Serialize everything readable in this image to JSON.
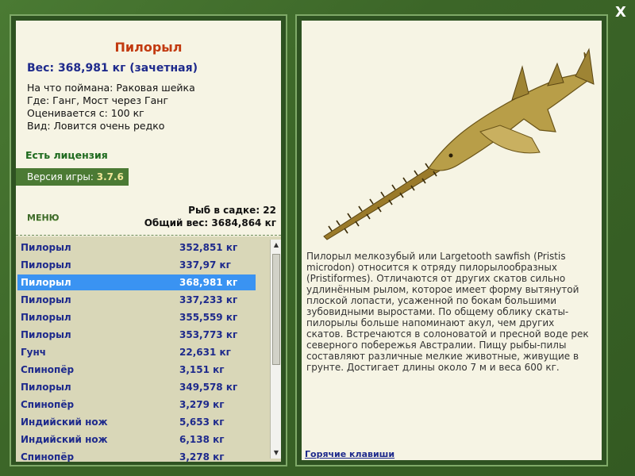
{
  "window": {
    "close_label": "X"
  },
  "fish": {
    "title": "Пилорыл",
    "weight_line": "Вес: 368,981 кг (зачетная)",
    "caught_on": "На что поймана: Раковая шейка",
    "location": "Где: Ганг, Мост через Ганг",
    "valued_from": "Оценивается с: 100 кг",
    "rarity": "Вид: Ловится очень редко"
  },
  "license": "Есть лицензия",
  "version": {
    "label": "Версия игры:",
    "value": "3.7.6"
  },
  "menu_label": "МЕНЮ",
  "stats": {
    "cage_count": "Рыб в садке: 22",
    "total_weight": "Общий вес: 3684,864 кг"
  },
  "catch_list": [
    {
      "name": "Пилорыл",
      "weight": "352,851 кг"
    },
    {
      "name": "Пилорыл",
      "weight": "337,97 кг"
    },
    {
      "name": "Пилорыл",
      "weight": "368,981 кг",
      "selected": true
    },
    {
      "name": "Пилорыл",
      "weight": "337,233 кг"
    },
    {
      "name": "Пилорыл",
      "weight": "355,559 кг"
    },
    {
      "name": "Пилорыл",
      "weight": "353,773 кг"
    },
    {
      "name": "Гунч",
      "weight": "22,631 кг"
    },
    {
      "name": "Спинопёр",
      "weight": "3,151 кг"
    },
    {
      "name": "Пилорыл",
      "weight": "349,578 кг"
    },
    {
      "name": "Спинопёр",
      "weight": "3,279 кг"
    },
    {
      "name": "Индийский нож",
      "weight": "5,653 кг"
    },
    {
      "name": "Индийский нож",
      "weight": "6,138 кг"
    },
    {
      "name": "Спинопёр",
      "weight": "3,278 кг"
    }
  ],
  "description": "Пилорыл мелкозубый или Largetooth sawfish (Pristis microdon) относится к отряду пилорылообразных (Pristiformes). Отличаются от других скатов сильно удлинённым рылом, которое имеет форму вытянутой плоской лопасти, усаженной по бокам большими зубовидными выростами. По общему облику скаты-пилорылы больше напоминают акул, чем других скатов. Встречаются в солоноватой и пресной воде рек северного побережья Австралии. Пищу рыбы-пилы составляют различные мелкие животные, живущие в грунте. Достигает длины около 7 м и веса 600 кг.",
  "hotkeys_label": "Горячие клавиши",
  "colors": {
    "title": "#c23a10",
    "weight": "#1e2a8c",
    "license": "#1e6a1e",
    "selection": "#3a93f2",
    "panel_bg": "#f6f4e4",
    "list_bg": "#d9d7b8",
    "frame": "#3f6b2a"
  }
}
